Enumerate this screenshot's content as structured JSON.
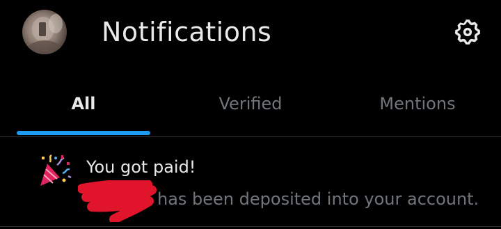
{
  "header": {
    "title": "Notifications",
    "avatar_icon": "user-avatar",
    "settings_icon": "gear-icon"
  },
  "tabs": [
    {
      "label": "All",
      "active": true
    },
    {
      "label": "Verified",
      "active": false
    },
    {
      "label": "Mentions",
      "active": false
    }
  ],
  "notification": {
    "icon": "party-popper-icon",
    "title": "You got paid!",
    "body": "has been deposited into your account."
  },
  "colors": {
    "background": "#000000",
    "text_primary": "#e7e9ea",
    "text_secondary": "#71767b",
    "accent": "#1d9bf0",
    "divider": "#2f3336",
    "redaction": "#e0142a"
  }
}
